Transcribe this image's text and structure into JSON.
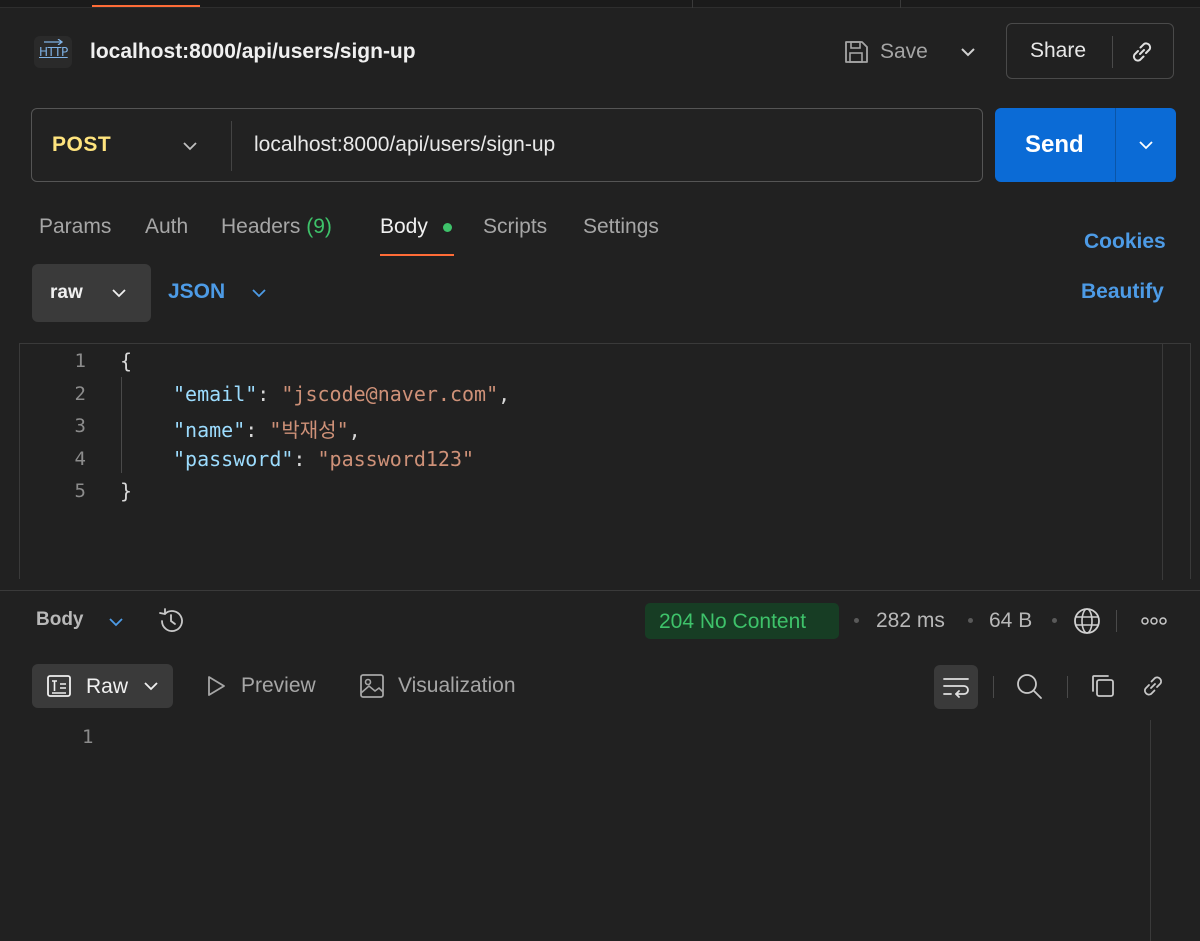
{
  "header": {
    "http_badge": "HTTP",
    "title": "localhost:8000/api/users/sign-up",
    "save_label": "Save",
    "share_label": "Share"
  },
  "request": {
    "method": "POST",
    "url": "localhost:8000/api/users/sign-up",
    "send_label": "Send"
  },
  "tabs": {
    "params": "Params",
    "auth": "Auth",
    "headers": "Headers",
    "headers_count": "(9)",
    "body": "Body",
    "scripts": "Scripts",
    "settings": "Settings",
    "cookies": "Cookies"
  },
  "body_options": {
    "mode": "raw",
    "language": "JSON",
    "beautify": "Beautify"
  },
  "editor": {
    "line_numbers": [
      "1",
      "2",
      "3",
      "4",
      "5"
    ],
    "lines": {
      "open": "{",
      "email_key": "\"email\"",
      "email_value": "\"jscode@naver.com\"",
      "name_key": "\"name\"",
      "name_value": "\"박재성\"",
      "password_key": "\"password\"",
      "password_value": "\"password123\"",
      "close": "}"
    }
  },
  "response": {
    "view_label": "Body",
    "status": "204 No Content",
    "time": "282 ms",
    "size": "64 B",
    "format_label": "Raw",
    "preview_label": "Preview",
    "visualization_label": "Visualization",
    "line_numbers": [
      "1"
    ]
  },
  "colors": {
    "accent": "#ff6c37",
    "send": "#0b6bd6",
    "method": "#ffe47e",
    "link": "#4d9be6",
    "status_ok": "#3ec26a"
  }
}
